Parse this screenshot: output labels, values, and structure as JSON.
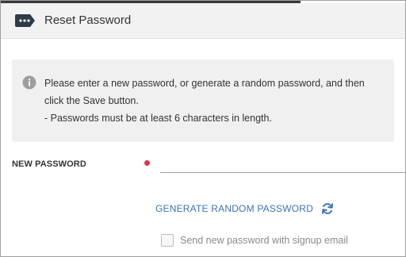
{
  "header": {
    "title": "Reset Password",
    "icon": "ellipsis-tag-icon"
  },
  "info": {
    "icon": "info-icon",
    "line1": "Please enter a new password, or generate a random password, and then",
    "line2": "click the Save button.",
    "line3": "- Passwords must be at least 6 characters in length."
  },
  "form": {
    "new_password_label": "NEW PASSWORD",
    "new_password_value": "",
    "required_color": "#e0334a"
  },
  "actions": {
    "generate_label": "GENERATE RANDOM PASSWORD",
    "generate_icon": "refresh-icon",
    "link_color": "#3b73b9"
  },
  "options": {
    "send_email_label": "Send new password with signup email",
    "send_email_checked": false
  }
}
